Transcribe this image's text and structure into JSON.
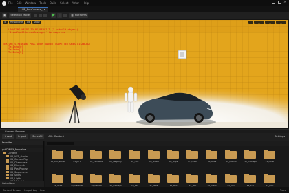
{
  "menubar": {
    "items": [
      "File",
      "Edit",
      "Window",
      "Tools",
      "Build",
      "Select",
      "Actor",
      "Help"
    ]
  },
  "tabbar": {
    "level_tab": "UPE_EnvCamera_1•"
  },
  "toolbar": {
    "mode_label": "Selection Mode",
    "platforms_label": "Platforms"
  },
  "viewport": {
    "buttons": [
      "Perspective",
      "Lit",
      "Show"
    ],
    "warnings": [
      "LIGHTING NEEDS TO BE REBUILT (1 unbuilt object)",
      "'DisableAllScreenMessages' to suppress",
      "TEXTURE STREAMING POOL OVER BUDGET (SOME TEXTURES DISABLED)",
      "TexInfo[0]",
      "TexInfo[1]",
      "TexInfo[2]"
    ],
    "colors": {
      "backdrop": "#e3a51c",
      "floor": "#f1f1f1",
      "car": "#3d4c58",
      "warning_text": "#e01010"
    }
  },
  "content_browser": {
    "title": "Content Browser",
    "add_label": "+ Add",
    "import_label": "Import",
    "save_all_label": "Save All",
    "breadcrumb": "All › Content",
    "settings_label": "Settings",
    "favorites_label": "Favorites",
    "project_label": "pcbDiMAX_Marcelina",
    "tree": [
      "Content",
      "00_UPE_studio",
      "01_CameraRig",
      "02_Characters",
      "03_Elements",
      "04_PostProcess",
      "05_Sequences",
      "06_Skies",
      "06_Lights",
      "06_Materials"
    ],
    "folders": [
      "00_UPE_studio",
      "01_JETS",
      "02_Elements",
      "03_Megacity",
      "04_FUN",
      "05_Mshop",
      "06_Maps",
      "07_HDRIs",
      "08_Skies",
      "09_Mounts",
      "10_Overlaps",
      "11_Other",
      "12_FILES",
      "13_Materials",
      "14_Meshes",
      "15_Overlays",
      "16_Kits",
      "17_Water",
      "18_Skill",
      "19_Test",
      "20_Outro",
      "21_Cam",
      "22_VFX",
      "23_Misc"
    ],
    "collections_label": "Collections"
  },
  "statusbar": {
    "items": [
      "Content Drawer",
      "Output Log",
      "Cmd"
    ],
    "right": "Trace"
  }
}
